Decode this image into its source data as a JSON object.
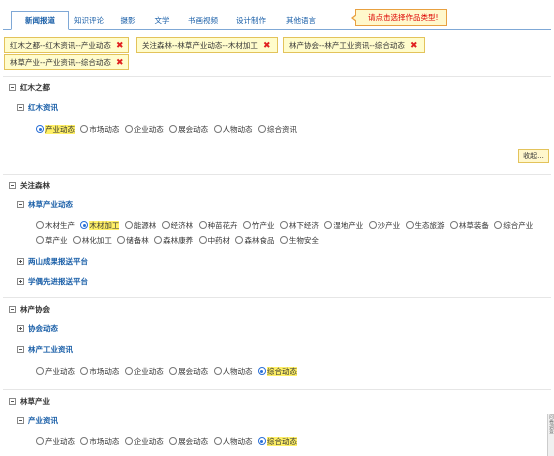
{
  "tabs": [
    "新闻报道",
    "知识评论",
    "摄影",
    "文学",
    "书画视频",
    "设计制作",
    "其他语言"
  ],
  "tooltip": "请点击选择作品类型!",
  "chips": [
    "红木之都--红木资讯--产业动态",
    "关注森林--林草产业动态--木材加工",
    "林产协会--林产工业资讯--综合动态",
    "林草产业--产业资讯--综合动态"
  ],
  "delete_glyph": "✖",
  "sections": {
    "hongmu": {
      "title": "红木之都",
      "sub_title": "红木资讯",
      "options": [
        "产业动态",
        "市场动态",
        "企业动态",
        "展会动态",
        "人物动态",
        "综合资讯"
      ],
      "collapse": "收起..."
    },
    "forest": {
      "title": "关注森林",
      "sub_title": "林草产业动态",
      "options_line1": [
        "木材生产",
        "木材加工",
        "能源林",
        "经济林",
        "种苗花卉",
        "竹产业",
        "林下经济",
        "湿地产业",
        "沙产业",
        "生态旅游",
        "林草装备",
        "综合产业"
      ],
      "options_line2": [
        "草产业",
        "林化加工",
        "储备林",
        "森林康养",
        "中药材",
        "森林食品",
        "生物安全"
      ],
      "extra_1": "两山成果报送平台",
      "extra_2": "学偶先进报送平台"
    },
    "assoc": {
      "title": "林产协会",
      "sub_title_1": "协会动态",
      "sub_title_2": "林产工业资讯",
      "options": [
        "产业动态",
        "市场动态",
        "企业动态",
        "展会动态",
        "人物动态",
        "综合动态"
      ]
    },
    "grass": {
      "title": "林草产业",
      "sub_title": "产业资讯",
      "options": [
        "产业动态",
        "市场动态",
        "企业动态",
        "展会动态",
        "人物动态",
        "综合动态"
      ]
    }
  },
  "side_strip": "问卷调查"
}
